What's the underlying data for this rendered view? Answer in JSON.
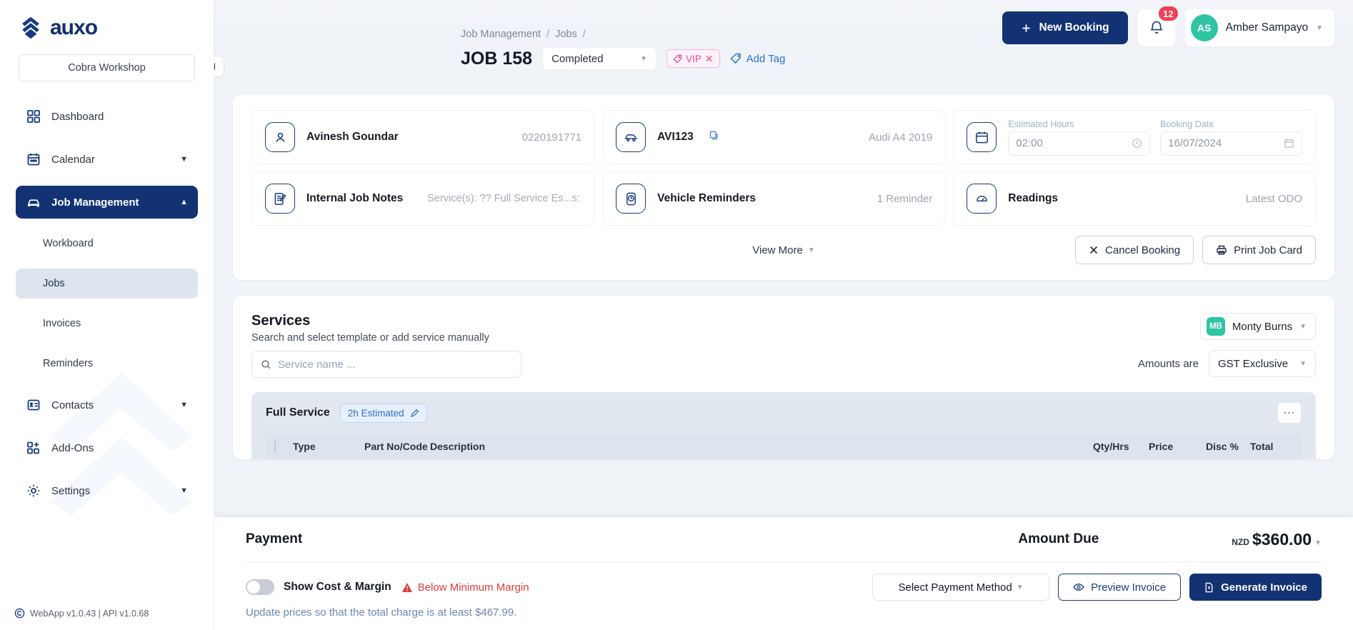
{
  "brand": {
    "name": "auxo",
    "logo_icon": "auxo-logo-icon"
  },
  "sidebar": {
    "workshop_label": "Cobra Workshop",
    "items": [
      {
        "label": "Dashboard",
        "icon": "dashboard-grid-icon",
        "active": false,
        "expandable": false
      },
      {
        "label": "Calendar",
        "icon": "calendar-icon",
        "active": false,
        "expandable": true
      },
      {
        "label": "Job Management",
        "icon": "car-icon",
        "active": true,
        "expandable": true
      },
      {
        "label": "Contacts",
        "icon": "contact-card-icon",
        "active": false,
        "expandable": true
      },
      {
        "label": "Add-Ons",
        "icon": "add-ons-grid-icon",
        "active": false,
        "expandable": false
      },
      {
        "label": "Settings",
        "icon": "gear-icon",
        "active": false,
        "expandable": true
      }
    ],
    "sub_items": [
      {
        "label": "Workboard",
        "selected": false
      },
      {
        "label": "Jobs",
        "selected": true
      },
      {
        "label": "Invoices",
        "selected": false
      },
      {
        "label": "Reminders",
        "selected": false
      }
    ],
    "version": "WebApp v1.0.43 | API  v1.0.68"
  },
  "topbar": {
    "new_booking_label": "New Booking",
    "notifications_count": "12",
    "user": {
      "initials": "AS",
      "name": "Amber Sampayo"
    }
  },
  "breadcrumb": {
    "items": [
      "Job Management",
      "Jobs"
    ],
    "separator": "/"
  },
  "job": {
    "title": "JOB 158",
    "status": "Completed",
    "tag": "VIP",
    "add_tag_label": "Add Tag"
  },
  "details": {
    "customer": {
      "label": "Avinesh Goundar",
      "value": "0220191771",
      "icon": "person-icon"
    },
    "vehicle": {
      "label": "AVI123",
      "value": "Audi A4 2019",
      "icon": "car-side-icon",
      "copy_icon": "copy-icon"
    },
    "schedule": {
      "icon": "calendar-icon",
      "estimated_hours_label": "Estimated Hours",
      "estimated_hours_value": "02:00",
      "booking_date_label": "Booking Date",
      "booking_date_value": "16/07/2024"
    },
    "notes": {
      "label": "Internal Job Notes",
      "value": "Service(s): ?? Full Service Es...s:",
      "icon": "notes-icon"
    },
    "reminders": {
      "label": "Vehicle Reminders",
      "value": "1 Reminder",
      "icon": "reminder-clock-icon"
    },
    "readings": {
      "label": "Readings",
      "value": "Latest ODO",
      "icon": "gauge-icon"
    },
    "view_more_label": "View More",
    "cancel_booking_label": "Cancel Booking",
    "print_job_card_label": "Print Job Card"
  },
  "services": {
    "title": "Services",
    "subtitle": "Search and select template or add service manually",
    "search_placeholder": "Service name ...",
    "assignee": {
      "initials": "MB",
      "name": "Monty Burns"
    },
    "amounts_label": "Amounts are",
    "gst_value": "GST Exclusive",
    "block": {
      "name": "Full Service",
      "estimate_chip": "2h Estimated"
    },
    "table_headers": [
      "Type",
      "Part No/Code",
      "Description",
      "Qty/Hrs",
      "Price",
      "Disc %",
      "Total"
    ]
  },
  "payment": {
    "title": "Payment",
    "amount_due_label": "Amount Due",
    "currency": "NZD",
    "amount": "$360.00",
    "show_cost_label": "Show Cost & Margin",
    "warning": "Below Minimum Margin",
    "hint": "Update prices so that the total charge is at least $467.99.",
    "select_payment_method": "Select Payment Method",
    "preview_invoice": "Preview Invoice",
    "generate_invoice": "Generate Invoice"
  },
  "colors": {
    "primary": "#123274",
    "accent_green": "#2ec4a4",
    "danger": "#e13b3b",
    "pink": "#e0509a",
    "link": "#2f6fd0"
  }
}
